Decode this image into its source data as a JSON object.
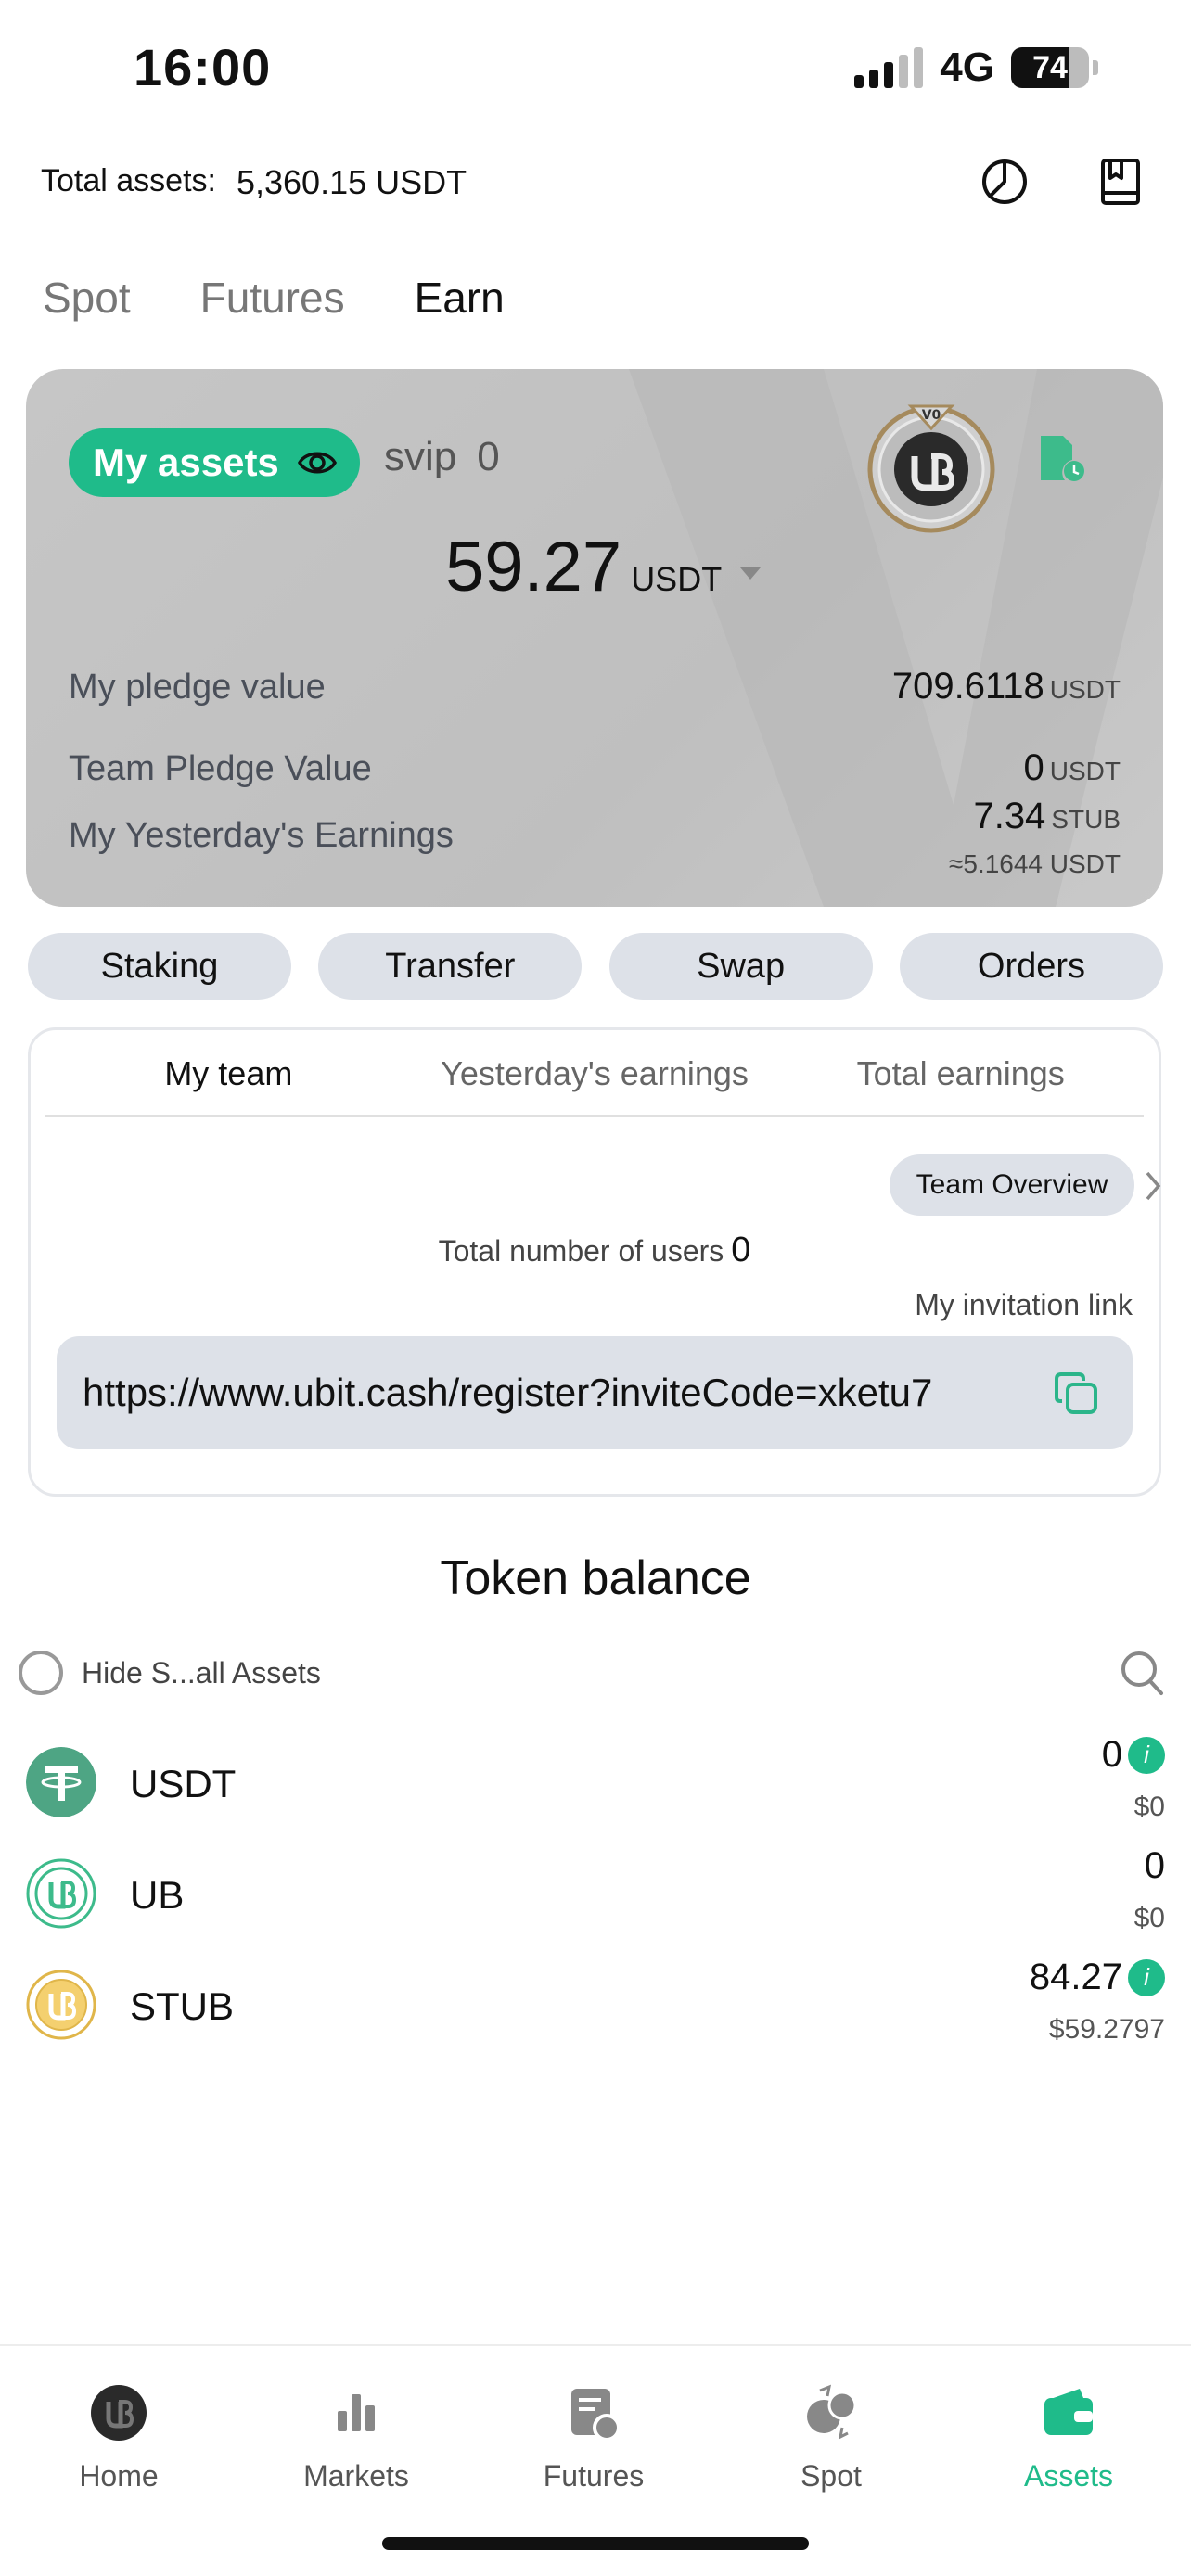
{
  "status_bar": {
    "time": "16:00",
    "network": "4G",
    "battery": "74",
    "battery_level": 0.74
  },
  "header": {
    "total_assets_label": "Total assets:",
    "total_assets_value": "5,360.15 USDT"
  },
  "tabs": [
    {
      "label": "Spot",
      "active": false
    },
    {
      "label": "Futures",
      "active": false
    },
    {
      "label": "Earn",
      "active": true
    }
  ],
  "card": {
    "my_assets_label": "My assets",
    "svip_label": "svip",
    "svip_level": "0",
    "badge_text": "V0",
    "amount": "59.27",
    "amount_unit": "USDT",
    "pledge_label": "My pledge value",
    "pledge_value": "709.6118",
    "pledge_unit": "USDT",
    "team_label": "Team Pledge Value",
    "team_value": "0",
    "team_unit": "USDT",
    "yest_label": "My Yesterday's Earnings",
    "yest_value": "7.34",
    "yest_unit": "STUB",
    "yest_approx": "≈5.1644 USDT"
  },
  "actions": [
    "Staking",
    "Transfer",
    "Swap",
    "Orders"
  ],
  "team": {
    "tabs": [
      {
        "label": "My team",
        "active": true
      },
      {
        "label": "Yesterday's earnings",
        "active": false
      },
      {
        "label": "Total earnings",
        "active": false
      }
    ],
    "overview_button": "Team Overview",
    "users_label": "Total number of users",
    "users_count": "0",
    "invite_label": "My invitation link",
    "invite_link": "https://www.ubit.cash/register?inviteCode=xketu7"
  },
  "token_balance": {
    "title": "Token balance",
    "hide_label": "Hide S...all Assets",
    "tokens": [
      {
        "name": "USDT",
        "amount": "0",
        "usd": "$0",
        "has_info": true
      },
      {
        "name": "UB",
        "amount": "0",
        "usd": "$0",
        "has_info": false
      },
      {
        "name": "STUB",
        "amount": "84.27",
        "usd": "$59.2797",
        "has_info": true
      }
    ],
    "info_glyph": "i"
  },
  "nav": [
    {
      "label": "Home",
      "icon": "home-icon"
    },
    {
      "label": "Markets",
      "icon": "markets-icon"
    },
    {
      "label": "Futures",
      "icon": "futures-icon"
    },
    {
      "label": "Spot",
      "icon": "spot-icon"
    },
    {
      "label": "Assets",
      "icon": "wallet-icon",
      "active": true
    }
  ],
  "colors": {
    "accent": "#1fbb8a",
    "pill_bg": "#dde1e8",
    "card_bg": "#c4c4c4"
  }
}
